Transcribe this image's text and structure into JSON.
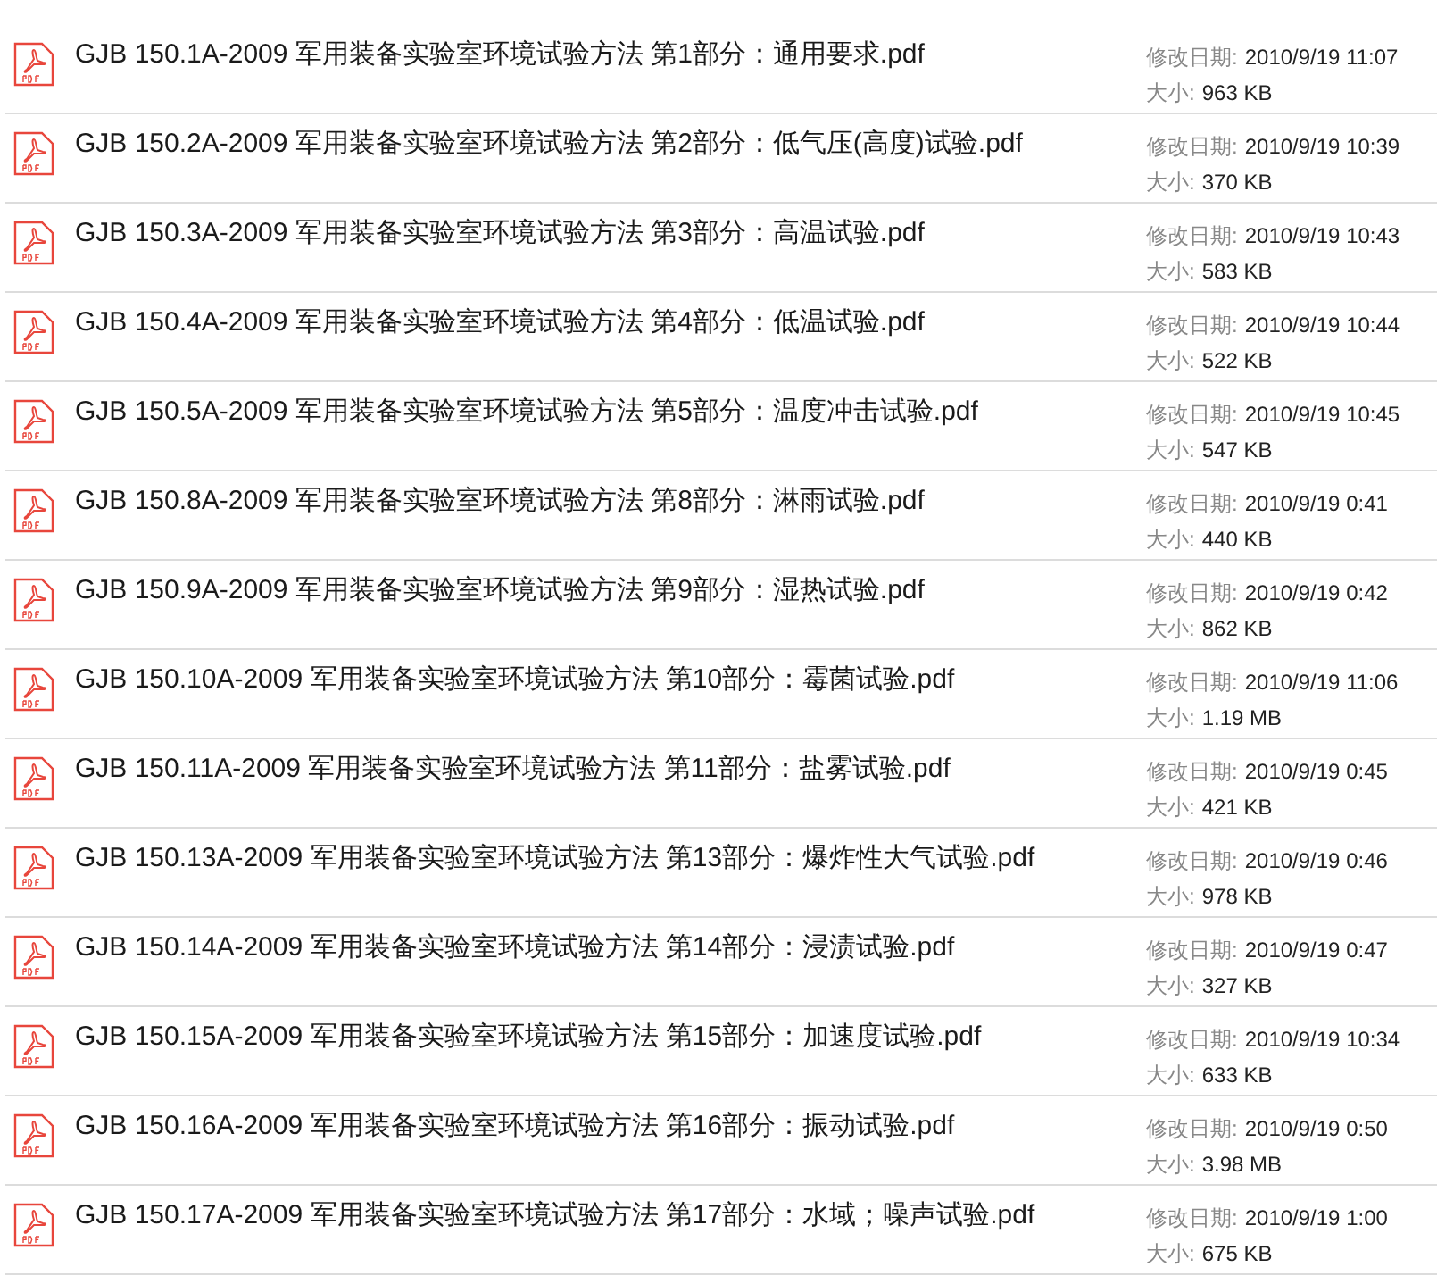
{
  "files": [
    {
      "name": "GJB 150.1A-2009 军用装备实验室环境试验方法 第1部分：通用要求.pdf",
      "date_label": "修改日期:",
      "date": "2010/9/19 11:07",
      "size_label": "大小:",
      "size": "963 KB"
    },
    {
      "name": "GJB 150.2A-2009 军用装备实验室环境试验方法 第2部分：低气压(高度)试验.pdf",
      "date_label": "修改日期:",
      "date": "2010/9/19 10:39",
      "size_label": "大小:",
      "size": "370 KB"
    },
    {
      "name": "GJB 150.3A-2009 军用装备实验室环境试验方法 第3部分：高温试验.pdf",
      "date_label": "修改日期:",
      "date": "2010/9/19 10:43",
      "size_label": "大小:",
      "size": "583 KB"
    },
    {
      "name": "GJB 150.4A-2009 军用装备实验室环境试验方法 第4部分：低温试验.pdf",
      "date_label": "修改日期:",
      "date": "2010/9/19 10:44",
      "size_label": "大小:",
      "size": "522 KB"
    },
    {
      "name": "GJB 150.5A-2009 军用装备实验室环境试验方法 第5部分：温度冲击试验.pdf",
      "date_label": "修改日期:",
      "date": "2010/9/19 10:45",
      "size_label": "大小:",
      "size": "547 KB"
    },
    {
      "name": "GJB 150.8A-2009 军用装备实验室环境试验方法 第8部分：淋雨试验.pdf",
      "date_label": "修改日期:",
      "date": "2010/9/19 0:41",
      "size_label": "大小:",
      "size": "440 KB"
    },
    {
      "name": "GJB 150.9A-2009 军用装备实验室环境试验方法 第9部分：湿热试验.pdf",
      "date_label": "修改日期:",
      "date": "2010/9/19 0:42",
      "size_label": "大小:",
      "size": "862 KB"
    },
    {
      "name": "GJB 150.10A-2009 军用装备实验室环境试验方法 第10部分：霉菌试验.pdf",
      "date_label": "修改日期:",
      "date": "2010/9/19 11:06",
      "size_label": "大小:",
      "size": "1.19 MB"
    },
    {
      "name": "GJB 150.11A-2009 军用装备实验室环境试验方法 第11部分：盐雾试验.pdf",
      "date_label": "修改日期:",
      "date": "2010/9/19 0:45",
      "size_label": "大小:",
      "size": "421 KB"
    },
    {
      "name": "GJB 150.13A-2009 军用装备实验室环境试验方法 第13部分：爆炸性大气试验.pdf",
      "date_label": "修改日期:",
      "date": "2010/9/19 0:46",
      "size_label": "大小:",
      "size": "978 KB"
    },
    {
      "name": "GJB 150.14A-2009 军用装备实验室环境试验方法 第14部分：浸渍试验.pdf",
      "date_label": "修改日期:",
      "date": "2010/9/19 0:47",
      "size_label": "大小:",
      "size": "327 KB"
    },
    {
      "name": "GJB 150.15A-2009 军用装备实验室环境试验方法 第15部分：加速度试验.pdf",
      "date_label": "修改日期:",
      "date": "2010/9/19 10:34",
      "size_label": "大小:",
      "size": "633 KB"
    },
    {
      "name": "GJB 150.16A-2009 军用装备实验室环境试验方法 第16部分：振动试验.pdf",
      "date_label": "修改日期:",
      "date": "2010/9/19 0:50",
      "size_label": "大小:",
      "size": "3.98 MB"
    },
    {
      "name": "GJB 150.17A-2009 军用装备实验室环境试验方法 第17部分：水域；噪声试验.pdf",
      "date_label": "修改日期:",
      "date": "2010/9/19 1:00",
      "size_label": "大小:",
      "size": "675 KB"
    }
  ]
}
